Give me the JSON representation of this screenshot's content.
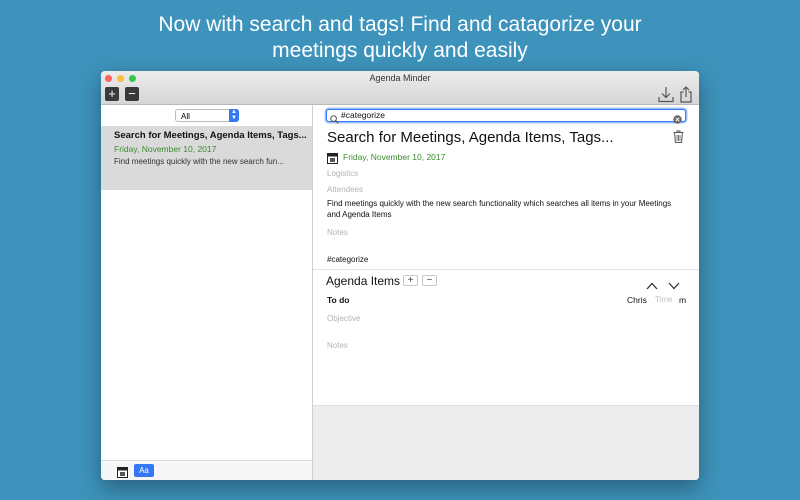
{
  "headline": {
    "line1": "Now with search and tags! Find and catagorize your",
    "line2": "meetings quickly and easily"
  },
  "window": {
    "title": "Agenda Minder",
    "toolbar": {
      "add_label": "+",
      "remove_label": "−",
      "icons": [
        "download-icon",
        "share-icon"
      ]
    }
  },
  "sidebar": {
    "filter": {
      "selected": "All"
    },
    "items": [
      {
        "title": "Search for Meetings, Agenda Items, Tags...",
        "date": "Friday, November 10, 2017",
        "snippet": "Find meetings quickly with the new search fun..."
      }
    ],
    "footer": {
      "font_button_label": "Aa"
    }
  },
  "main": {
    "search": {
      "value": "#categorize"
    },
    "title": "Search for Meetings, Agenda Items, Tags...",
    "date": "Friday, November 10, 2017",
    "placeholders": {
      "logistics": "Logistics",
      "attendees": "Attendees",
      "notes": "Notes"
    },
    "description": "Find meetings quickly with the new search functionality which searches all items in your Meetings and Agenda Items",
    "tag": "#categorize",
    "agenda": {
      "heading": "Agenda Items",
      "add_label": "+",
      "remove_label": "−",
      "item": {
        "title": "To do",
        "assignee": "Chris",
        "time_placeholder": "Time",
        "time_unit": "m",
        "objective_placeholder": "Objective",
        "notes_placeholder": "Notes"
      }
    }
  },
  "colors": {
    "background": "#3d93bb",
    "accent": "#3478f6",
    "date_green": "#3d8b2f",
    "selection": "#dadada"
  }
}
